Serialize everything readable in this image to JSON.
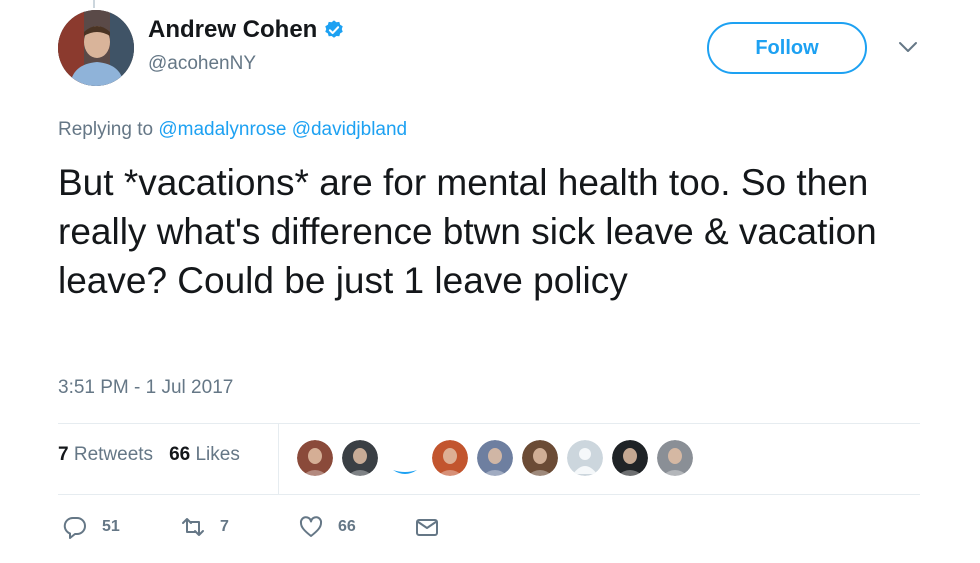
{
  "user": {
    "display_name": "Andrew Cohen",
    "handle": "@acohenNY",
    "verified_icon": "verified-badge-icon",
    "avatar": "profile-photo"
  },
  "header": {
    "follow_label": "Follow",
    "menu_icon": "chevron-down-icon"
  },
  "reply": {
    "prefix": "Replying to",
    "mentions": [
      "@madalynrose",
      "@davidjbland"
    ]
  },
  "tweet": {
    "text": "But *vacations* are for mental health too. So then really what's difference btwn sick leave & vacation leave? Could be just 1 leave policy",
    "timestamp": "3:51 PM - 1 Jul 2017"
  },
  "stats": {
    "retweets_count": "7",
    "retweets_label": "Retweets",
    "likes_count": "66",
    "likes_label": "Likes"
  },
  "likers": [
    {
      "name": "liker-avatar-1",
      "color": "#8a4a3a"
    },
    {
      "name": "liker-avatar-2",
      "color": "#3a3f44"
    },
    {
      "name": "liker-avatar-3",
      "color": "#1da1f2"
    },
    {
      "name": "liker-avatar-4",
      "color": "#c2552e"
    },
    {
      "name": "liker-avatar-5",
      "color": "#6e7fa0"
    },
    {
      "name": "liker-avatar-6",
      "color": "#6b4b35"
    },
    {
      "name": "liker-avatar-7",
      "color": "#ccd6dd"
    },
    {
      "name": "liker-avatar-8",
      "color": "#1f2326"
    },
    {
      "name": "liker-avatar-9",
      "color": "#8a8f96"
    }
  ],
  "actions": {
    "reply_count": "51",
    "retweet_count": "7",
    "like_count": "66",
    "icons": [
      "reply-icon",
      "retweet-icon",
      "like-icon",
      "message-icon"
    ]
  },
  "colors": {
    "accent": "#1da1f2",
    "text": "#14171a",
    "secondary": "#657786",
    "divider": "#e6ecf0"
  }
}
